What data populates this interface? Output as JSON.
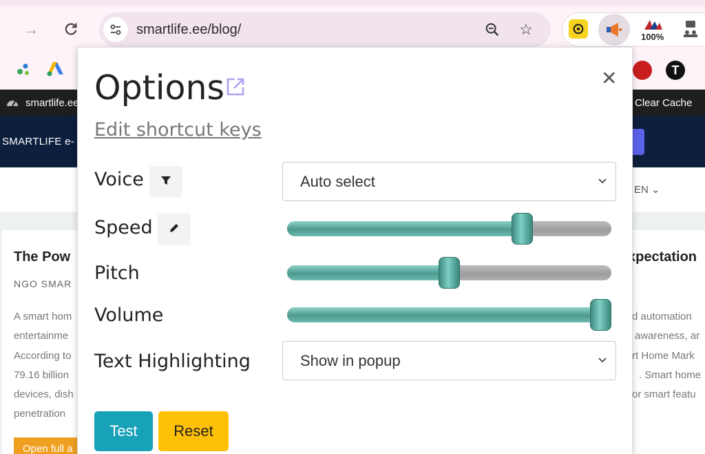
{
  "browser": {
    "url": "smartlife.ee/blog/",
    "extension_badge": "100%"
  },
  "page": {
    "admin_site": "smartlife.ee",
    "clear_cache": "Clear Cache",
    "brand": "SMARTLIFE e-",
    "language": "EN",
    "card_left": {
      "title": "The Pow",
      "byline": "NGO SMAR",
      "lines": [
        "A smart hom",
        "entertainme",
        "According to",
        "79.16 billion",
        "devices, dish",
        "penetration"
      ],
      "button": "Open full a"
    },
    "card_right": {
      "title": "xpectation",
      "lines": [
        "d automation",
        "awareness, ar",
        "rt Home Mark",
        ". Smart home",
        "or smart featu"
      ]
    }
  },
  "popup": {
    "title": "Options",
    "edit_shortcuts": "Edit shortcut keys",
    "voice": {
      "label": "Voice",
      "value": "Auto select"
    },
    "speed": {
      "label": "Speed",
      "value": 0.74
    },
    "pitch": {
      "label": "Pitch",
      "value": 0.5
    },
    "volume": {
      "label": "Volume",
      "value": 1.0
    },
    "highlighting": {
      "label": "Text Highlighting",
      "value": "Show in popup"
    },
    "test_label": "Test",
    "reset_label": "Reset"
  },
  "colors": {
    "accent_teal": "#5fb3a7",
    "test_btn": "#17a2b8",
    "reset_btn": "#ffc107"
  }
}
